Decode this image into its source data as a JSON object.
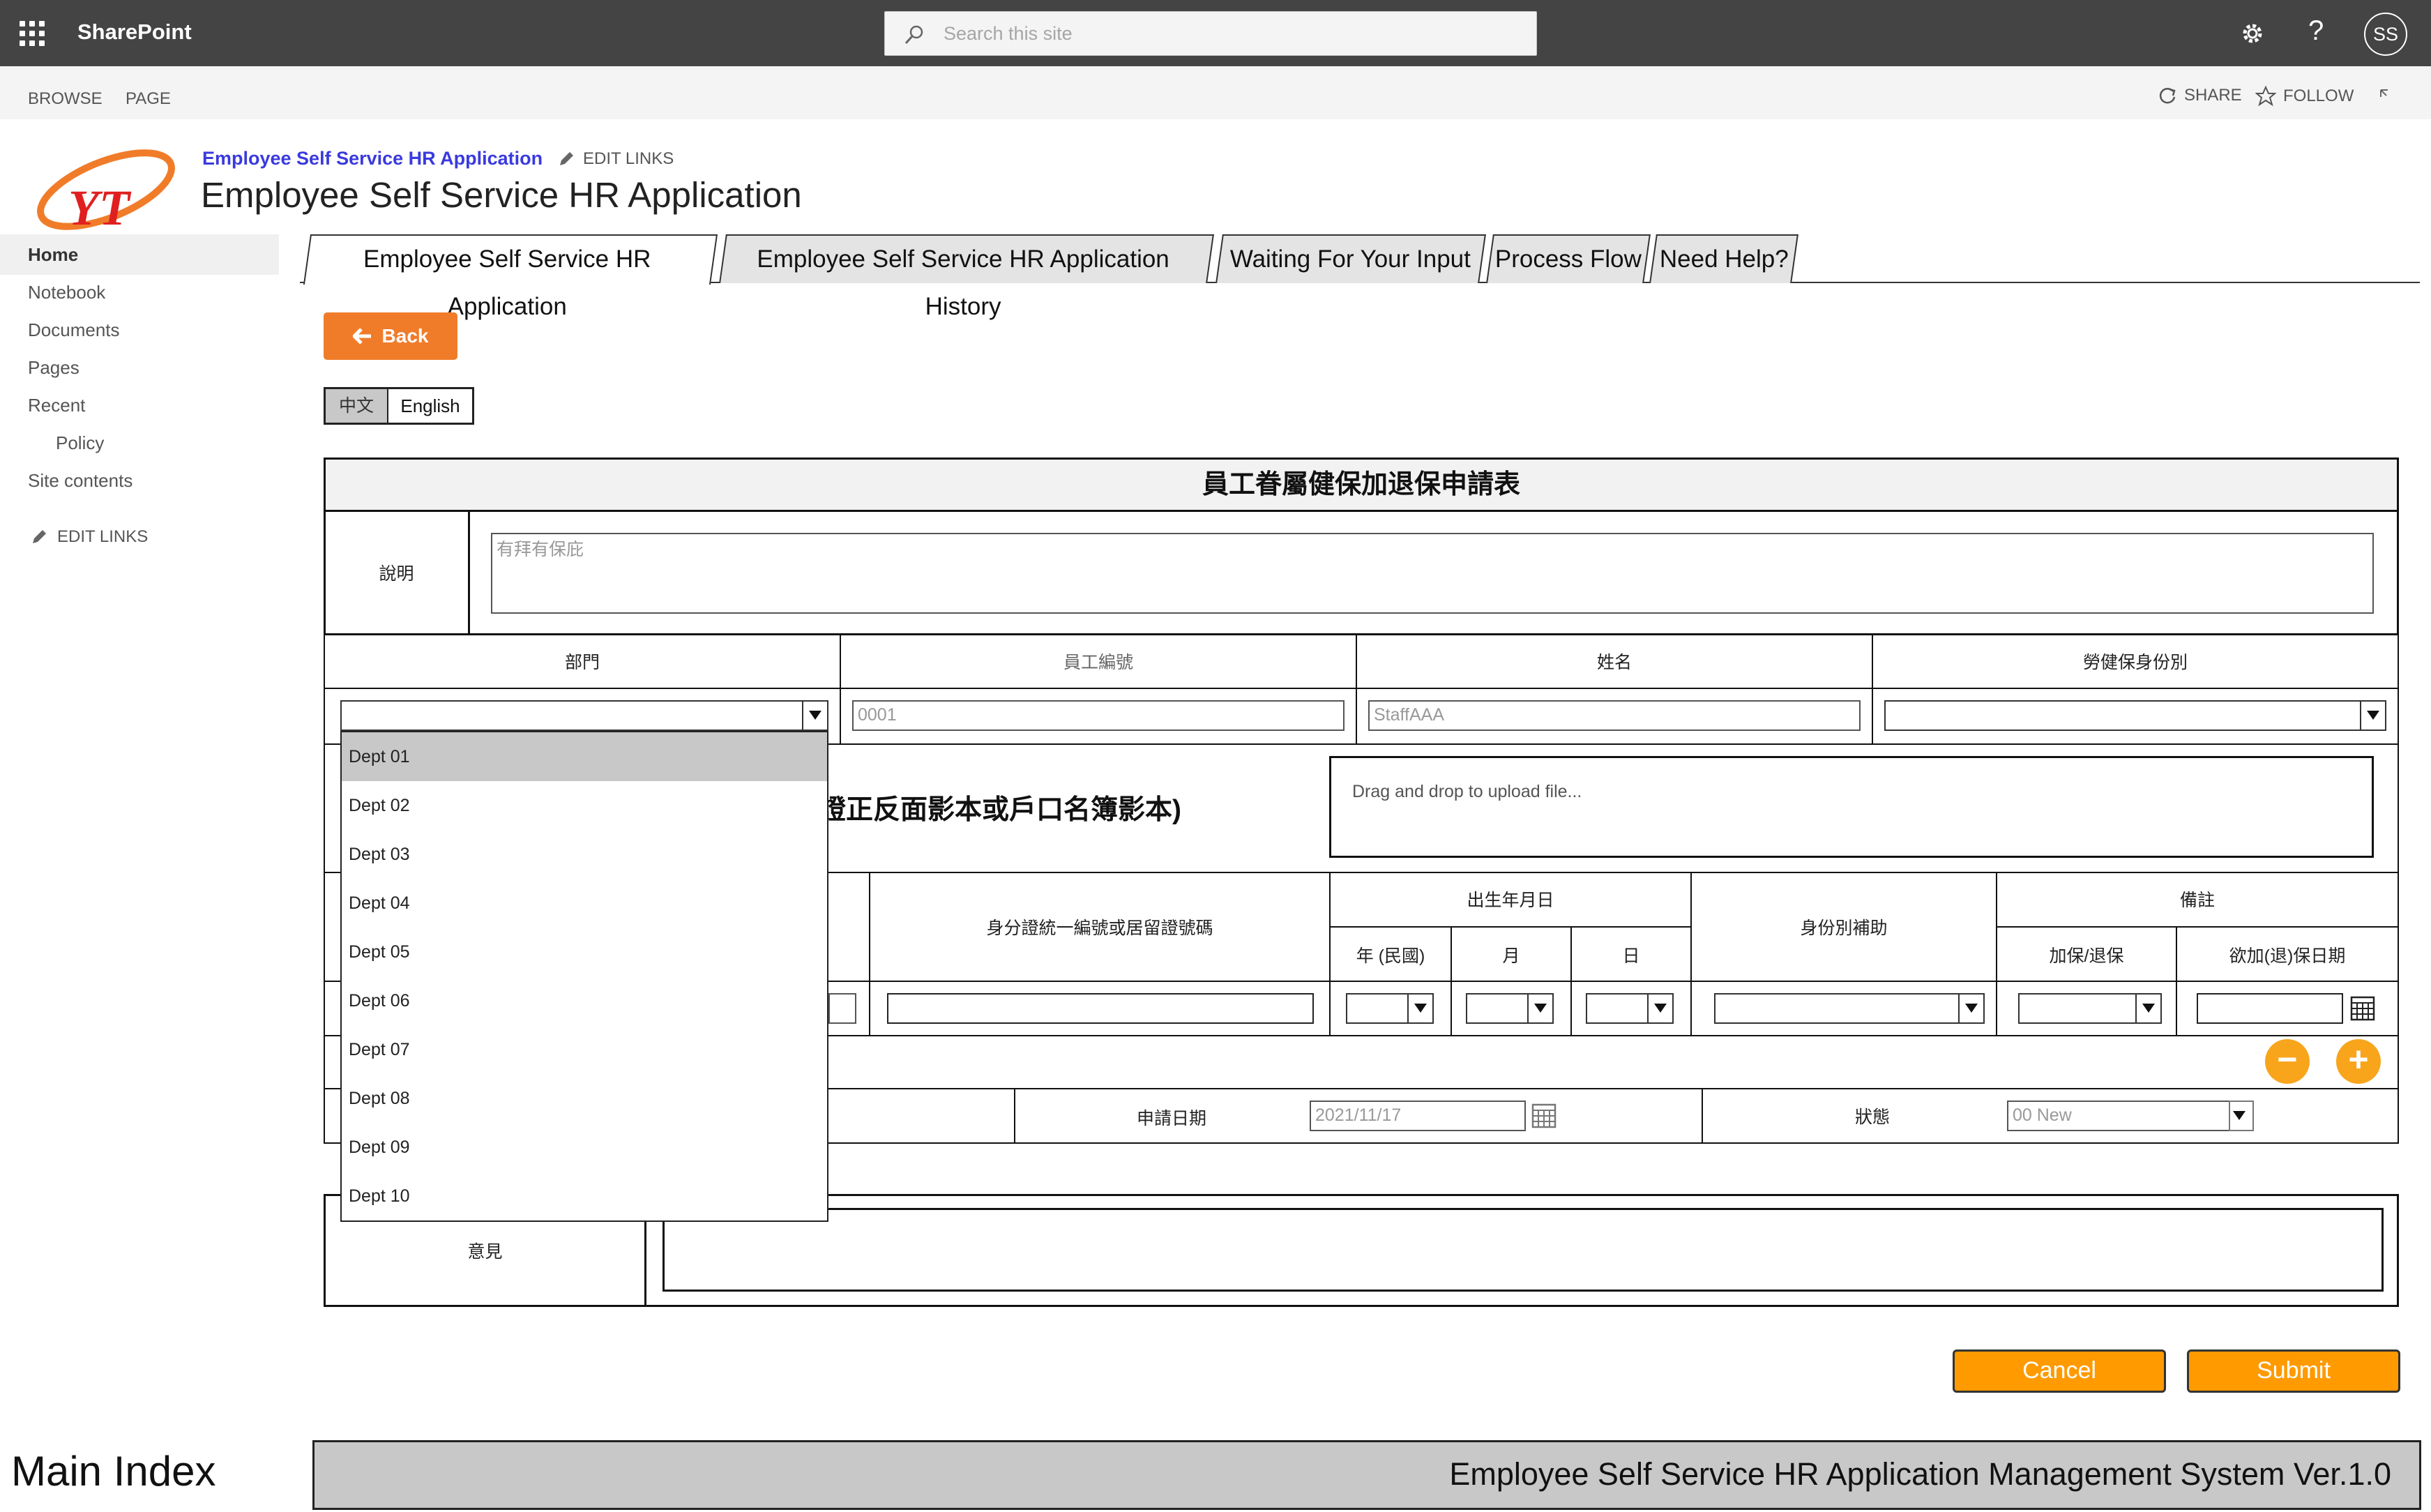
{
  "suite_bar": {
    "brand": "SharePoint",
    "search_placeholder": "Search this site",
    "avatar_initials": "SS",
    "help_label": "?"
  },
  "ribbon": {
    "browse": "BROWSE",
    "page": "PAGE",
    "share": "SHARE",
    "follow": "FOLLOW"
  },
  "header": {
    "site_link": "Employee Self Service HR Application",
    "edit_links": "EDIT LINKS",
    "site_title": "Employee Self Service HR Application"
  },
  "left_nav": {
    "items": [
      "Home",
      "Notebook",
      "Documents",
      "Pages",
      "Recent",
      "Policy",
      "Site contents"
    ],
    "edit_links": "EDIT LINKS"
  },
  "tabs": [
    "Employee Self Service HR Application",
    "Employee Self Service HR Application History",
    "Waiting For Your Input",
    "Process Flow",
    "Need Help?"
  ],
  "back_label": "Back",
  "lang": {
    "zh": "中文",
    "en": "English"
  },
  "form": {
    "title": "員工眷屬健保加退保申請表",
    "desc_label": "說明",
    "desc_placeholder": "有拜有保庇",
    "dept_label": "部門",
    "empno_label": "員工編號",
    "empno_value": "0001",
    "name_label": "姓名",
    "name_value": "StaffAAA",
    "insurance_id_label": "勞健保身份別",
    "upload_text_partial": "證正反面影本或戶口名簿影本)",
    "upload_placeholder": "Drag and drop to upload file...",
    "id_no_label": "身分證統一編號或居留證號碼",
    "birth_label": "出生年月日",
    "year_label": "年 (民國)",
    "month_label": "月",
    "day_label": "日",
    "subsidy_label": "身份別補助",
    "remark_label": "備註",
    "add_remove_label": "加保/退保",
    "date_label": "欲加(退)保日期",
    "apply_date_label": "申請日期",
    "apply_date_value": "2021/11/17",
    "status_label": "狀態",
    "status_value": "00 New",
    "opinion_label": "意見"
  },
  "dept_options": [
    "Dept 01",
    "Dept 02",
    "Dept 03",
    "Dept 04",
    "Dept 05",
    "Dept 06",
    "Dept 07",
    "Dept 08",
    "Dept 09",
    "Dept 10"
  ],
  "cancel_label": "Cancel",
  "submit_label": "Submit",
  "footer": {
    "left": "Main Index",
    "right": "Employee Self Service HR Application Management System Ver.1.0"
  },
  "colors": {
    "suite_bar": "#444444",
    "accent_orange": "#f07c2a",
    "button_orange": "#ff9a00",
    "round_orange": "#f8a51c",
    "link_blue": "#3a3adf"
  }
}
